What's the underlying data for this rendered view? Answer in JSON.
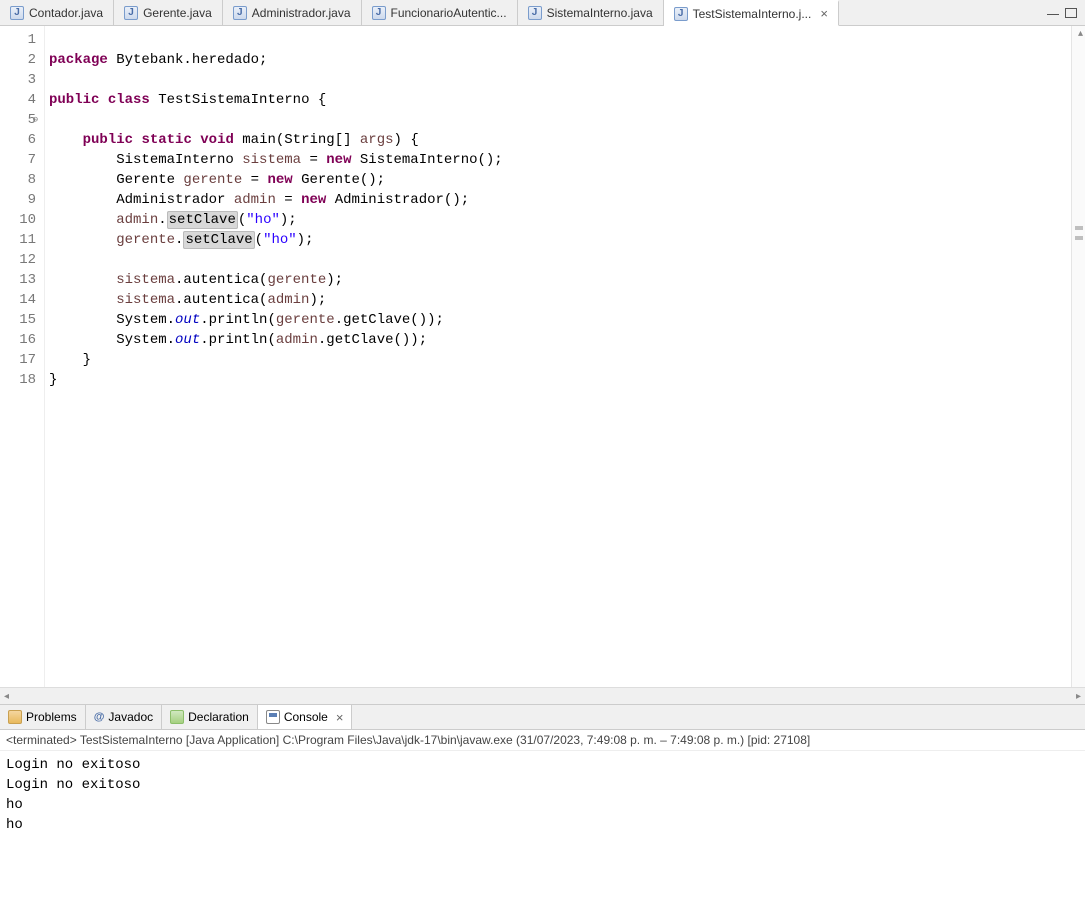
{
  "tabs": [
    {
      "label": "Contador.java"
    },
    {
      "label": "Gerente.java"
    },
    {
      "label": "Administrador.java"
    },
    {
      "label": "FuncionarioAutentic..."
    },
    {
      "label": "SistemaInterno.java"
    },
    {
      "label": "TestSistemaInterno.j...",
      "active": true
    }
  ],
  "code": {
    "line1_kw1": "package",
    "line1_rest": " Bytebank.heredado;",
    "line3_kw1": "public",
    "line3_kw2": "class",
    "line3_rest": " TestSistemaInterno {",
    "line5_kw1": "public",
    "line5_kw2": "static",
    "line5_kw3": "void",
    "line5_mid": " main(String[] ",
    "line5_var": "args",
    "line5_end": ") {",
    "line6_a": "        SistemaInterno ",
    "line6_var": "sistema",
    "line6_b": " = ",
    "line6_kw": "new",
    "line6_c": " SistemaInterno();",
    "line7_a": "        Gerente ",
    "line7_var": "gerente",
    "line7_b": " = ",
    "line7_kw": "new",
    "line7_c": " Gerente();",
    "line8_a": "        Administrador ",
    "line8_var": "admin",
    "line8_b": " = ",
    "line8_kw": "new",
    "line8_c": " Administrador();",
    "line9_a": "        ",
    "line9_var": "admin",
    "line9_b": ".",
    "line9_hl": "setClave",
    "line9_c": "(",
    "line9_str": "\"ho\"",
    "line9_d": ");",
    "line10_a": "        ",
    "line10_var": "gerente",
    "line10_b": ".",
    "line10_hl": "setClave",
    "line10_c": "(",
    "line10_str": "\"ho\"",
    "line10_d": ");",
    "line12_a": "        ",
    "line12_var1": "sistema",
    "line12_b": ".autentica(",
    "line12_var2": "gerente",
    "line12_c": ");",
    "line13_a": "        ",
    "line13_var1": "sistema",
    "line13_b": ".autentica(",
    "line13_var2": "admin",
    "line13_c": ");",
    "line14_a": "        System.",
    "line14_field": "out",
    "line14_b": ".println(",
    "line14_var": "gerente",
    "line14_c": ".getClave());",
    "line15_a": "        System.",
    "line15_field": "out",
    "line15_b": ".println(",
    "line15_var": "admin",
    "line15_c": ".getClave());",
    "line16": "    }",
    "line17": "}",
    "line18": ""
  },
  "lineNumbers": [
    "1",
    "2",
    "3",
    "4",
    "5",
    "6",
    "7",
    "8",
    "9",
    "10",
    "11",
    "12",
    "13",
    "14",
    "15",
    "16",
    "17",
    "18"
  ],
  "views": [
    {
      "label": "Problems"
    },
    {
      "label": "Javadoc"
    },
    {
      "label": "Declaration"
    },
    {
      "label": "Console",
      "active": true
    }
  ],
  "javadocAt": "@",
  "terminated": "<terminated> TestSistemaInterno [Java Application] C:\\Program Files\\Java\\jdk-17\\bin\\javaw.exe  (31/07/2023, 7:49:08 p. m. – 7:49:08 p. m.) [pid: 27108]",
  "consoleOutput": "Login no exitoso\nLogin no exitoso\nho\nho"
}
